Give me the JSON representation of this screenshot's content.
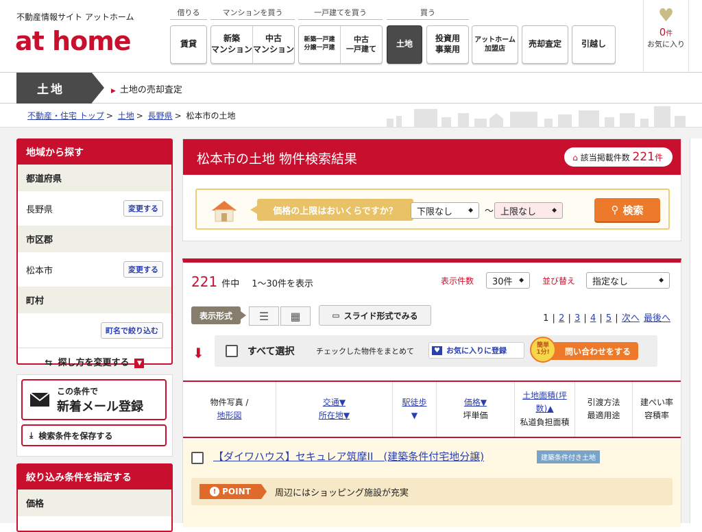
{
  "header": {
    "site_tagline": "不動産情報サイト アットホーム",
    "logo": "at home",
    "groups": [
      {
        "label": "借りる"
      },
      {
        "label": "マンションを買う"
      },
      {
        "label": "一戸建てを買う"
      },
      {
        "label": "買う"
      }
    ],
    "nav": {
      "rent": "賃貸",
      "new_mansion": "新築\nマンション",
      "used_mansion": "中古\nマンション",
      "new_house": "新築一戸建\n分譲一戸建",
      "used_house": "中古\n一戸建て",
      "land": "土地",
      "investment": "投資用\n事業用",
      "athome_shop": "アットホーム\n加盟店",
      "sale_assessment": "売却査定",
      "moving": "引越し"
    },
    "favorites": {
      "count": "0",
      "unit": "件",
      "label": "お気に入り"
    }
  },
  "category": {
    "tab": "土地",
    "link": "土地の売却査定"
  },
  "breadcrumb": {
    "items": [
      "不動産・住宅 トップ",
      "土地",
      "長野県"
    ],
    "current": "松本市の土地"
  },
  "sidebar": {
    "area_title": "地域から探す",
    "pref_label": "都道府県",
    "pref_value": "長野県",
    "change_label": "変更する",
    "city_label": "市区郡",
    "city_value": "松本市",
    "town_label": "町村",
    "town_filter": "町名で絞り込む",
    "change_method": "探し方を変更する",
    "mail_line1": "この条件で",
    "mail_line2": "新着メール登録",
    "save_conditions": "検索条件を保存する",
    "refine_title": "絞り込み条件を指定する",
    "price_label": "価格"
  },
  "search": {
    "title": "松本市の土地 物件検索結果",
    "count_label": "該当掲載件数",
    "count_value": "221",
    "count_unit": "件",
    "price_question": "価格の上限はおいくらですか？",
    "lower_limit": "下限なし",
    "upper_limit": "上限なし",
    "tilde": "〜",
    "search_button": "検索"
  },
  "results": {
    "total": "221",
    "total_suffix": "件中",
    "range": "1〜30件を表示",
    "per_page_label": "表示件数",
    "per_page_value": "30件",
    "sort_label": "並び替え",
    "sort_value": "指定なし",
    "view_label": "表示形式",
    "slide_button": "スライド形式でみる",
    "pages": [
      "1",
      "2",
      "3",
      "4",
      "5"
    ],
    "next": "次へ",
    "last": "最後へ",
    "select_all": "すべて選択",
    "checked_note": "チェックした物件をまとめて",
    "fav_button": "お気に入りに登録",
    "badge": "簡単\n1分!",
    "inquiry_button": "問い合わせをする"
  },
  "table_headers": {
    "photo": "物件写真 /",
    "shape": "地形図",
    "traffic": "交通▼",
    "location": "所在地▼",
    "walk": "駅徒歩",
    "walk_arrow": "▼",
    "price": "価格▼",
    "unit_price": "坪単価",
    "area": "土地面積(坪",
    "area2": "数)▲",
    "private_road": "私道負担面積",
    "handover": "引渡方法",
    "usage": "最適用途",
    "coverage": "建ぺい率",
    "floor_ratio": "容積率"
  },
  "listing": {
    "title": "【ダイワハウス】セキュレア筑摩II　(建築条件付宅地分譲)",
    "tag": "建築条件付き土地",
    "point_label": "POINT",
    "point_text": "周辺にはショッピング施設が充実"
  },
  "colors": {
    "brand": "#c8102e",
    "accent_orange": "#ec7a2a"
  }
}
